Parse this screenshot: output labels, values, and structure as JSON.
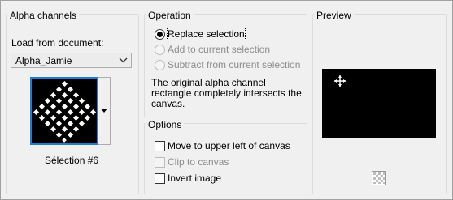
{
  "alpha": {
    "title": "Alpha channels",
    "load_label": "Load from document:",
    "load_mnemonic": "d",
    "document_value": "Alpha_Jamie",
    "selection_name": "Sélection #6"
  },
  "operation": {
    "title": "Operation",
    "options": [
      {
        "label": "Replace selection",
        "selected": true,
        "enabled": true
      },
      {
        "label": "Add to current selection",
        "selected": false,
        "enabled": false
      },
      {
        "label": "Subtract from current selection",
        "selected": false,
        "enabled": false
      }
    ],
    "message_line1": "The original alpha channel",
    "message_line2": "rectangle completely intersects the",
    "message_line3": "canvas."
  },
  "options": {
    "title": "Options",
    "items": [
      {
        "label": "Move to upper left of canvas",
        "checked": false,
        "enabled": true
      },
      {
        "label": "Clip to canvas",
        "checked": false,
        "enabled": false
      },
      {
        "label": "Invert image",
        "checked": false,
        "enabled": true
      }
    ]
  },
  "preview": {
    "title": "Preview"
  }
}
